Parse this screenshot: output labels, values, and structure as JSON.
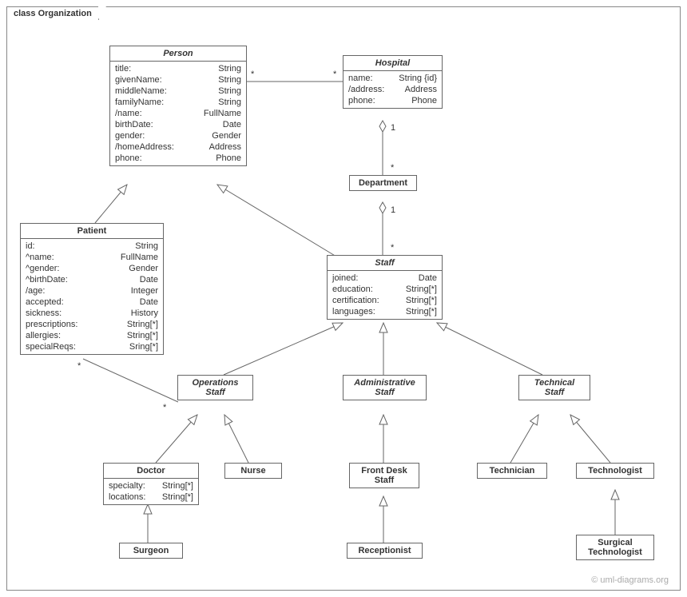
{
  "frame": {
    "title": "class Organization"
  },
  "watermark": "© uml-diagrams.org",
  "classes": {
    "person": {
      "name": "Person",
      "attrs": [
        [
          "title:",
          "String"
        ],
        [
          "givenName:",
          "String"
        ],
        [
          "middleName:",
          "String"
        ],
        [
          "familyName:",
          "String"
        ],
        [
          "/name:",
          "FullName"
        ],
        [
          "birthDate:",
          "Date"
        ],
        [
          "gender:",
          "Gender"
        ],
        [
          "/homeAddress:",
          "Address"
        ],
        [
          "phone:",
          "Phone"
        ]
      ]
    },
    "hospital": {
      "name": "Hospital",
      "attrs": [
        [
          "name:",
          "String {id}"
        ],
        [
          "/address:",
          "Address"
        ],
        [
          "phone:",
          "Phone"
        ]
      ]
    },
    "department": {
      "name": "Department"
    },
    "patient": {
      "name": "Patient",
      "attrs": [
        [
          "id:",
          "String"
        ],
        [
          "^name:",
          "FullName"
        ],
        [
          "^gender:",
          "Gender"
        ],
        [
          "^birthDate:",
          "Date"
        ],
        [
          "/age:",
          "Integer"
        ],
        [
          "accepted:",
          "Date"
        ],
        [
          "sickness:",
          "History"
        ],
        [
          "prescriptions:",
          "String[*]"
        ],
        [
          "allergies:",
          "String[*]"
        ],
        [
          "specialReqs:",
          "Sring[*]"
        ]
      ]
    },
    "staff": {
      "name": "Staff",
      "attrs": [
        [
          "joined:",
          "Date"
        ],
        [
          "education:",
          "String[*]"
        ],
        [
          "certification:",
          "String[*]"
        ],
        [
          "languages:",
          "String[*]"
        ]
      ]
    },
    "opsstaff": {
      "name": "Operations\nStaff"
    },
    "adminstaff": {
      "name": "Administrative\nStaff"
    },
    "techstaff": {
      "name": "Technical\nStaff"
    },
    "doctor": {
      "name": "Doctor",
      "attrs": [
        [
          "specialty:",
          "String[*]"
        ],
        [
          "locations:",
          "String[*]"
        ]
      ]
    },
    "nurse": {
      "name": "Nurse"
    },
    "frontdesk": {
      "name": "Front Desk\nStaff"
    },
    "receptionist": {
      "name": "Receptionist"
    },
    "technician": {
      "name": "Technician"
    },
    "technologist": {
      "name": "Technologist"
    },
    "surgeon": {
      "name": "Surgeon"
    },
    "surgtech": {
      "name": "Surgical\nTechnologist"
    }
  },
  "multiplicities": {
    "person_hospital_l": "*",
    "person_hospital_r": "*",
    "hospital_dept_top": "1",
    "hospital_dept_bot": "*",
    "dept_staff_top": "1",
    "dept_staff_bot": "*",
    "patient_ops_l": "*",
    "patient_ops_r": "*"
  }
}
